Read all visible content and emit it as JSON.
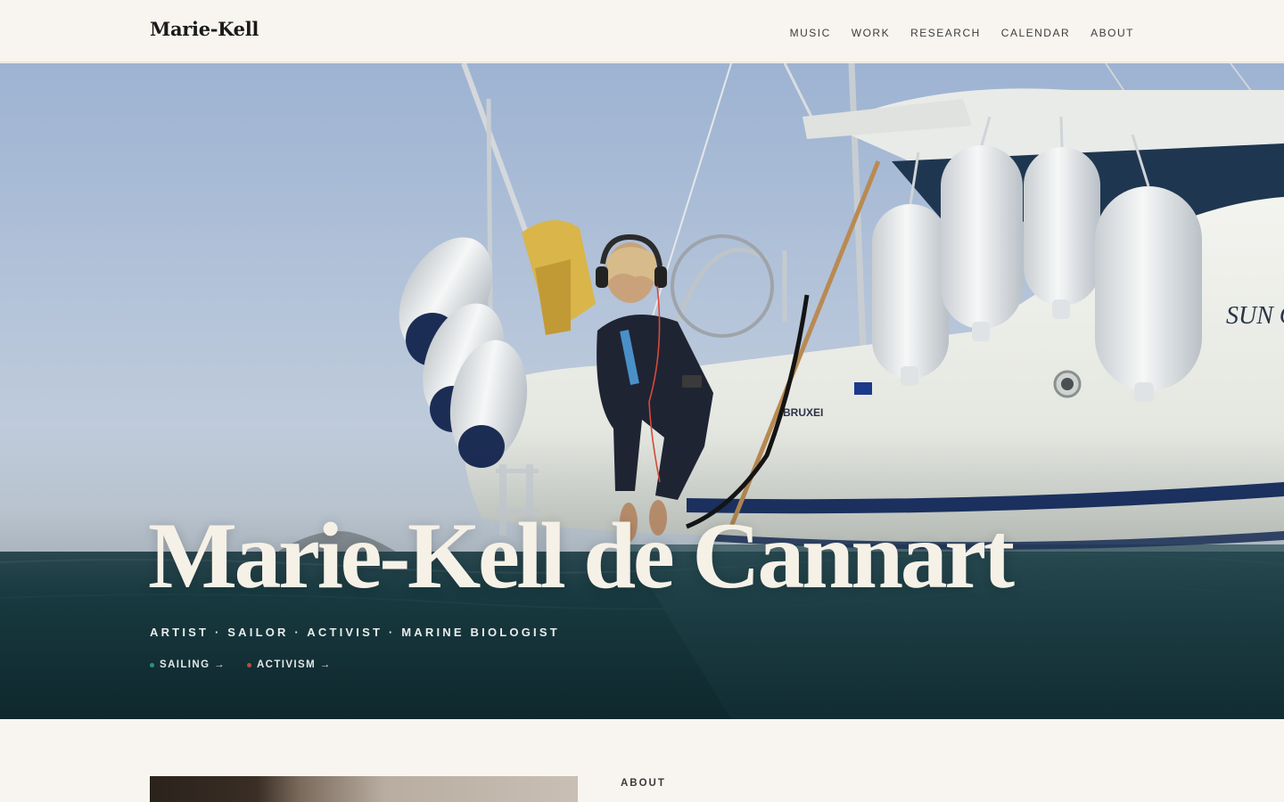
{
  "header": {
    "logo": "Marie-Kell",
    "nav": [
      {
        "label": "MUSIC"
      },
      {
        "label": "WORK"
      },
      {
        "label": "RESEARCH"
      },
      {
        "label": "CALENDAR"
      },
      {
        "label": "ABOUT"
      }
    ]
  },
  "hero": {
    "title": "Marie-Kell de Cannart",
    "roles": "ARTIST · SAILOR · ACTIVIST · MARINE BIOLOGIST",
    "links": [
      {
        "label": "SAILING →",
        "dot_color": "#2f8f7a"
      },
      {
        "label": "ACTIVISM →",
        "dot_color": "#b0503f"
      }
    ],
    "hull_text": "SUN O",
    "hull_text_2": "BRUXEI"
  },
  "about": {
    "label": "ABOUT"
  },
  "colors": {
    "background": "#f8f5f0",
    "sky": "#b3c3d9",
    "sea": "#15373d",
    "hull": "#eef0ea"
  }
}
